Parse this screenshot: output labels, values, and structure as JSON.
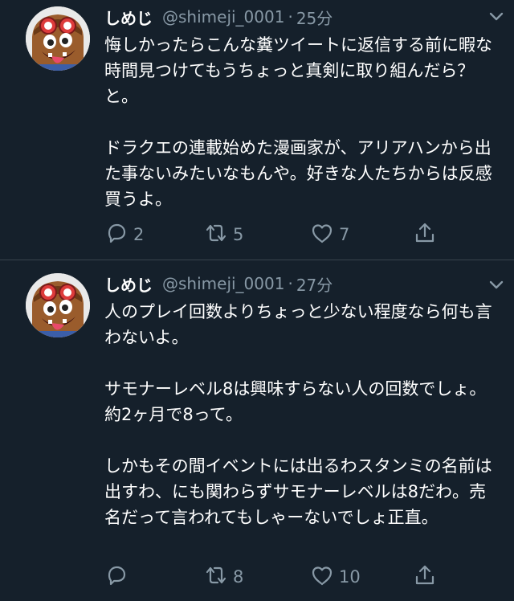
{
  "tweets": [
    {
      "display_name": "しめじ",
      "handle": "@shimeji_0001",
      "separator": "·",
      "time": "25分",
      "text": "悔しかったらこんな糞ツイートに返信する前に暇な時間見つけてもうちょっと真剣に取り組んだら？と。\n\nドラクエの連載始めた漫画家が、アリアハンから出た事ないみたいなもんや。好きな人たちからは反感買うよ。",
      "reply_count": "2",
      "retweet_count": "5",
      "like_count": "7",
      "icons": [
        "reply-icon",
        "retweet-icon",
        "like-icon",
        "share-icon",
        "chevron-down-icon"
      ]
    },
    {
      "display_name": "しめじ",
      "handle": "@shimeji_0001",
      "separator": "·",
      "time": "27分",
      "text": "人のプレイ回数よりちょっと少ない程度なら何も言わないよ。\n\nサモナーレベル8は興味すらない人の回数でしょ。約2ヶ月で8って。\n\nしかもその間イベントには出るわスタンミの名前は出すわ、にも関わらずサモナーレベルは8だわ。売名だって言われてもしゃーないでしょ正直。",
      "reply_count": "",
      "retweet_count": "8",
      "like_count": "10",
      "icons": [
        "reply-icon",
        "retweet-icon",
        "like-icon",
        "share-icon",
        "chevron-down-icon"
      ]
    }
  ],
  "colors": {
    "background": "#15202b",
    "text": "#ffffff",
    "secondary": "#8899a6",
    "divider": "#38444d"
  }
}
